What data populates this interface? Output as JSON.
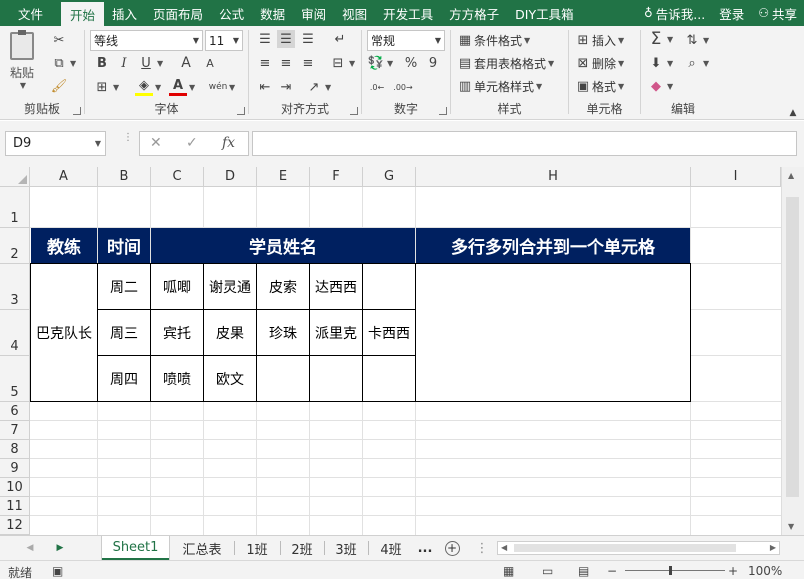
{
  "tabs": [
    "文件",
    "开始",
    "插入",
    "页面布局",
    "公式",
    "数据",
    "审阅",
    "视图",
    "开发工具",
    "方方格子",
    "DIY工具箱"
  ],
  "active_tab": "开始",
  "tell_me": "告诉我...",
  "login": "登录",
  "share": "共享",
  "ribbon": {
    "clipboard": {
      "label": "剪贴板",
      "paste": "粘贴"
    },
    "font": {
      "label": "字体",
      "name": "等线",
      "size": "11",
      "bold": "B",
      "italic": "I",
      "underline": "U",
      "grow": "A",
      "shrink": "A",
      "phonetic": "wén"
    },
    "align": {
      "label": "对齐方式"
    },
    "number": {
      "label": "数字",
      "format": "常规",
      "percent": "%",
      "comma": "9"
    },
    "styles": {
      "label": "样式",
      "cond": "条件格式",
      "table": "套用表格格式",
      "cell": "单元格样式"
    },
    "cells": {
      "label": "单元格",
      "insert": "插入",
      "delete": "删除",
      "format": "格式"
    },
    "edit": {
      "label": "编辑"
    }
  },
  "formula": {
    "name_box": "D9",
    "fx": "fx",
    "value": ""
  },
  "columns": [
    "A",
    "B",
    "C",
    "D",
    "E",
    "F",
    "G",
    "H",
    "I"
  ],
  "rows": [
    "1",
    "2",
    "3",
    "4",
    "5",
    "6",
    "7",
    "8",
    "9",
    "10",
    "11",
    "12"
  ],
  "table": {
    "h_coach": "教练",
    "h_time": "时间",
    "h_names": "学员姓名",
    "h_merge": "多行多列合并到一个单元格",
    "coach": "巴克队长",
    "times": [
      "周二",
      "周三",
      "周四"
    ],
    "r3": [
      "呱唧",
      "谢灵通",
      "皮索",
      "达西西",
      ""
    ],
    "r4": [
      "宾托",
      "皮果",
      "珍珠",
      "派里克",
      "卡西西"
    ],
    "r5": [
      "喷喷",
      "欧文",
      "",
      "",
      ""
    ]
  },
  "sheets": [
    "Sheet1",
    "汇总表",
    "1班",
    "2班",
    "3班",
    "4班"
  ],
  "sheet_more": "...",
  "active_sheet": "Sheet1",
  "status": {
    "ready": "就绪",
    "zoom": "100%"
  }
}
